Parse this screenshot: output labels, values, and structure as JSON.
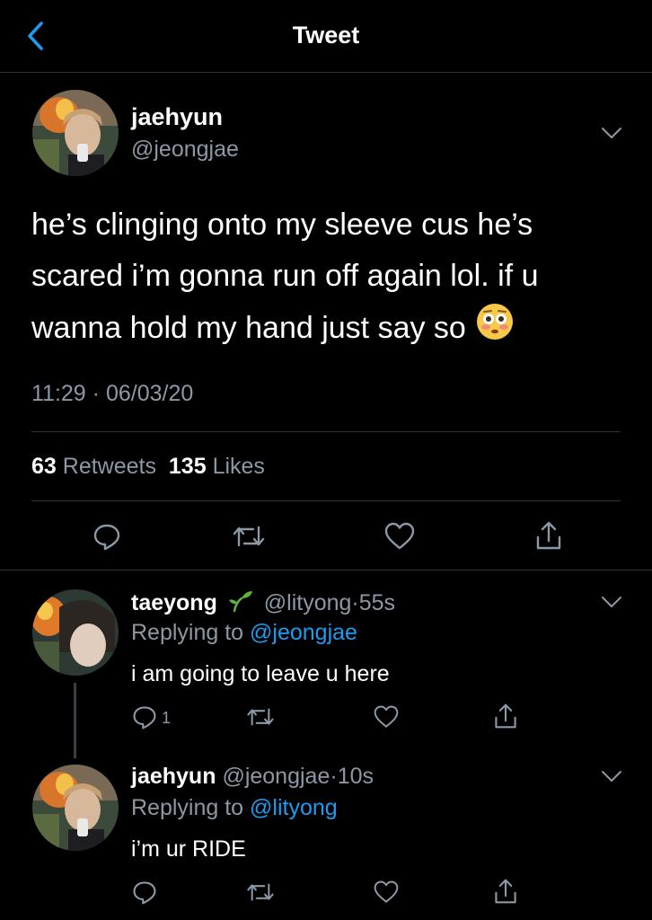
{
  "header": {
    "title": "Tweet"
  },
  "tweet": {
    "author_name": "jaehyun",
    "author_handle": "@jeongjae",
    "text": "he’s clinging onto my sleeve cus he’s scared i’m gonna run off again lol. if u wanna hold my hand just say so",
    "emoji": "flushed-face-emoji",
    "time": "11:29",
    "separator": " · ",
    "date": "06/03/20",
    "retweet_count": "63",
    "retweet_label": "Retweets",
    "like_count": "135",
    "like_label": "Likes"
  },
  "replies": [
    {
      "name": "taeyong",
      "badge_icon": "seedling-icon",
      "handle": "@lityong",
      "separator": "·",
      "age": "55s",
      "replying_to_label": "Replying to",
      "replying_to_handle": "@jeongjae",
      "text": "i am going to leave u here",
      "reply_count": "1"
    },
    {
      "name": "jaehyun",
      "handle": "@jeongjae",
      "separator": "·",
      "age": "10s",
      "replying_to_label": "Replying to",
      "replying_to_handle": "@lityong",
      "text": "i’m ur RIDE"
    }
  ],
  "colors": {
    "background": "#000000",
    "text": "#ffffff",
    "muted": "#8b98a5",
    "link": "#1d9bf0",
    "divider": "#2f3336",
    "seedling": "#5fb33b"
  }
}
